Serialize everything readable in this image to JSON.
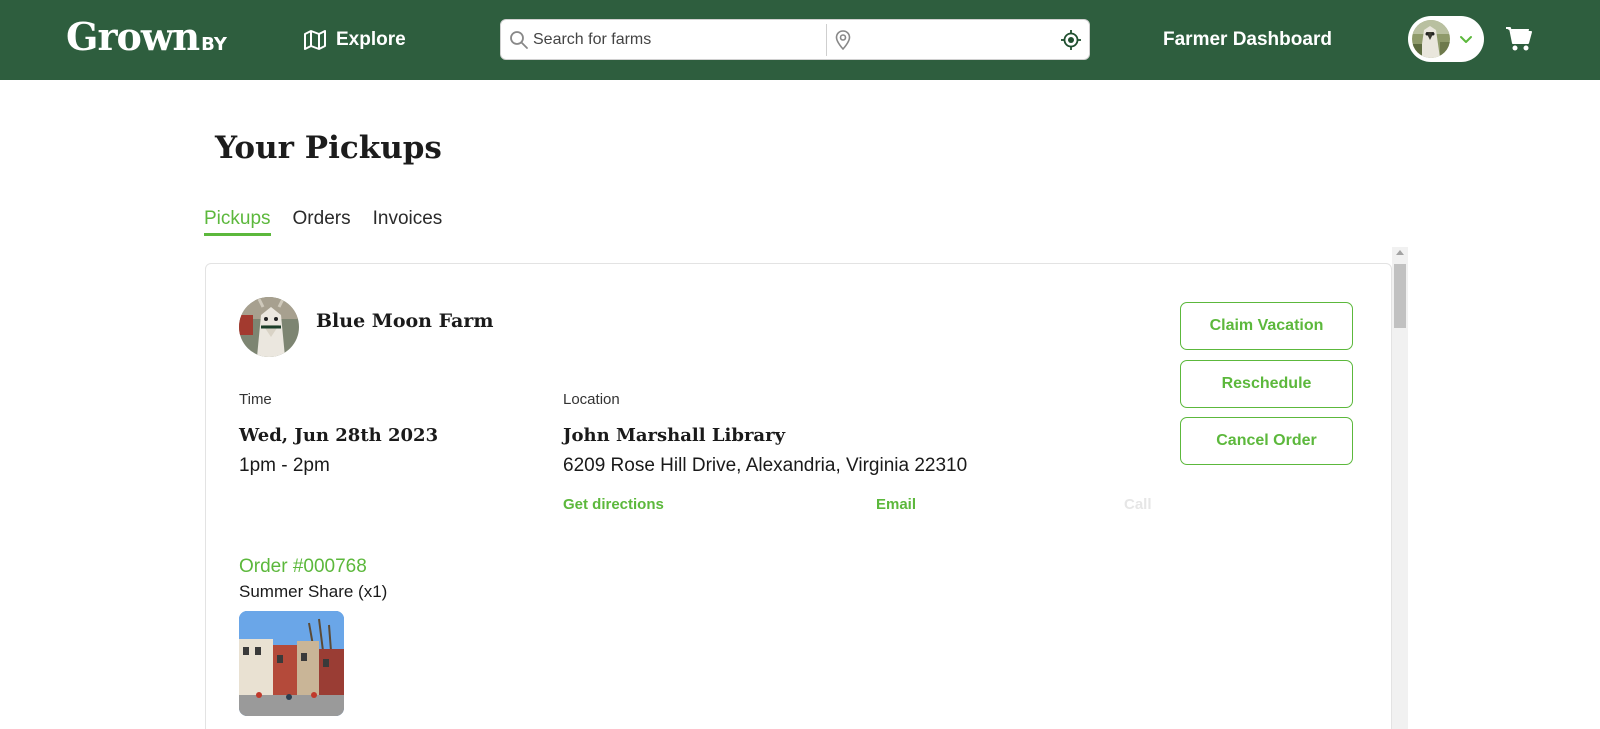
{
  "header": {
    "logo_main": "Grown",
    "logo_by": "BY",
    "explore_label": "Explore",
    "search_placeholder": "Search for farms",
    "location_value": "",
    "farmer_dashboard_label": "Farmer Dashboard"
  },
  "page": {
    "title": "Your Pickups",
    "tabs": [
      {
        "label": "Pickups",
        "active": true
      },
      {
        "label": "Orders",
        "active": false
      },
      {
        "label": "Invoices",
        "active": false
      }
    ]
  },
  "pickup": {
    "farm_name": "Blue Moon Farm",
    "time_label": "Time",
    "location_label": "Location",
    "date": "Wed, Jun 28th 2023",
    "hours": "1pm - 2pm",
    "location_name": "John Marshall Library",
    "address": "6209 Rose Hill Drive, Alexandria, Virginia 22310",
    "links": {
      "directions": "Get directions",
      "email": "Email",
      "call": "Call"
    },
    "actions": {
      "claim_vacation": "Claim Vacation",
      "reschedule": "Reschedule",
      "cancel_order": "Cancel Order"
    },
    "order": {
      "number": "Order #000768",
      "item": "Summer Share (x1)"
    }
  },
  "colors": {
    "header_bg": "#2e5e3e",
    "accent": "#5cb83c",
    "disabled": "#e6e6e6"
  }
}
